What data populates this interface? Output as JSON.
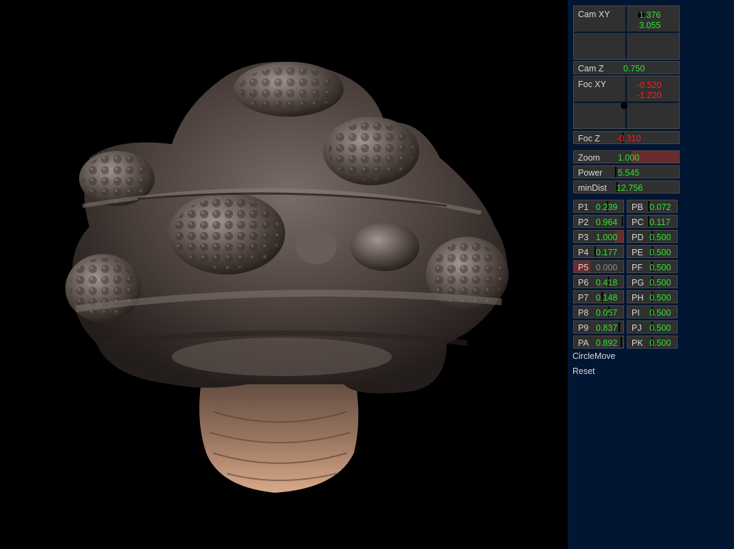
{
  "cam_xy": {
    "label": "Cam XY",
    "x": "1.376",
    "y": "3.055"
  },
  "cam_z": {
    "label": "Cam Z",
    "value": "0.750"
  },
  "foc_xy": {
    "label": "Foc XY",
    "x": "-0.520",
    "y": "-1.220"
  },
  "foc_z": {
    "label": "Foc Z",
    "value": "-0.310"
  },
  "zoom": {
    "label": "Zoom",
    "value": "1.000"
  },
  "power": {
    "label": "Power",
    "value": "5.545"
  },
  "mindist": {
    "label": "minDist",
    "value": "12.756"
  },
  "params_left": [
    {
      "label": "P1",
      "value": "0.239"
    },
    {
      "label": "P2",
      "value": "0.964"
    },
    {
      "label": "P3",
      "value": "1.000"
    },
    {
      "label": "P4",
      "value": "0.177"
    },
    {
      "label": "P5",
      "value": "0.000"
    },
    {
      "label": "P6",
      "value": "0.418"
    },
    {
      "label": "P7",
      "value": "0.148"
    },
    {
      "label": "P8",
      "value": "0.057"
    },
    {
      "label": "P9",
      "value": "0.837"
    },
    {
      "label": "PA",
      "value": "0.892"
    }
  ],
  "params_right": [
    {
      "label": "PB",
      "value": "0.072"
    },
    {
      "label": "PC",
      "value": "0.117"
    },
    {
      "label": "PD",
      "value": "0.500"
    },
    {
      "label": "PE",
      "value": "0.500"
    },
    {
      "label": "PF",
      "value": "0.500"
    },
    {
      "label": "PG",
      "value": "0.500"
    },
    {
      "label": "PH",
      "value": "0.500"
    },
    {
      "label": "PI",
      "value": "0.500"
    },
    {
      "label": "PJ",
      "value": "0.500"
    },
    {
      "label": "PK",
      "value": "0.500"
    }
  ],
  "actions": {
    "circle_move": "CircleMove",
    "reset": "Reset"
  },
  "colors": {
    "panel_bg": "#001633",
    "control_bg": "#303030",
    "positive": "#2fe52f",
    "negative": "#ff2020",
    "highlight": "#6a2e2e"
  }
}
